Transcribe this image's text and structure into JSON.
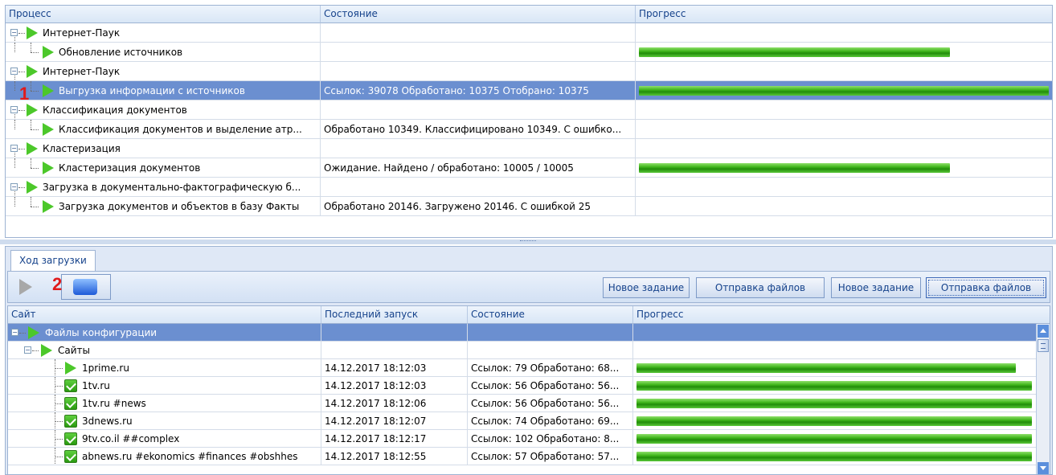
{
  "top_grid": {
    "columns": [
      "Процесс",
      "Состояние",
      "Прогресс"
    ],
    "rows": [
      {
        "level": 0,
        "expander": "⊖",
        "name": "Интернет-Паук",
        "state": "",
        "progress": null
      },
      {
        "level": 1,
        "name": "Обновление источников",
        "state": "",
        "progress": 0.75
      },
      {
        "level": 0,
        "expander": "⊖",
        "name": "Интернет-Паук",
        "state": "",
        "progress": null
      },
      {
        "level": 1,
        "name": "Выгрузка информации с источников",
        "state": "Ссылок: 39078 Обработано: 10375 Отобрано: 10375",
        "progress": 1.0,
        "selected": true
      },
      {
        "level": 0,
        "expander": "⊖",
        "name": "Классификация документов",
        "state": "",
        "progress": null
      },
      {
        "level": 1,
        "name": "Классификация документов и выделение атр...",
        "state": "Обработано 10349. Классифицировано 10349. С ошибко...",
        "progress": null
      },
      {
        "level": 0,
        "expander": "⊖",
        "name": "Кластеризация",
        "state": "",
        "progress": null
      },
      {
        "level": 1,
        "name": "Кластеризация документов",
        "state": "Ожидание. Найдено / обработано: 10005 / 10005",
        "progress": 0.75
      },
      {
        "level": 0,
        "expander": "⊖",
        "name": "Загрузка в документально-фактографическую б...",
        "state": "",
        "progress": null
      },
      {
        "level": 1,
        "name": "Загрузка документов и объектов в базу Факты",
        "state": "Обработано 20146. Загружено 20146. С ошибкой 25",
        "progress": null
      }
    ]
  },
  "markers": {
    "one": "1",
    "two": "2"
  },
  "bottom": {
    "tab_label": "Ход загрузки",
    "toolbar": {
      "buttons": [
        "Новое задание",
        "Отправка файлов",
        "Новое задание",
        "Отправка файлов"
      ]
    },
    "grid": {
      "columns": [
        "Сайт",
        "Последний запуск",
        "Состояние",
        "Прогресс"
      ],
      "rows": [
        {
          "level": 0,
          "expander": "⊖",
          "icon": "play",
          "site": "Файлы конфигурации",
          "last_run": "",
          "state": "",
          "progress": null,
          "selected": true
        },
        {
          "level": 1,
          "expander": "⊖",
          "icon": "play",
          "site": "Сайты",
          "last_run": "",
          "state": "",
          "progress": null
        },
        {
          "level": 2,
          "icon": "play",
          "site": "1prime.ru",
          "last_run": "14.12.2017 18:12:03",
          "state": "Ссылок: 79 Обработано: 68...",
          "progress": 0.96
        },
        {
          "level": 2,
          "icon": "check",
          "site": "1tv.ru",
          "last_run": "14.12.2017 18:12:03",
          "state": "Ссылок: 56 Обработано: 56...",
          "progress": 1.0
        },
        {
          "level": 2,
          "icon": "check",
          "site": "1tv.ru #news",
          "last_run": "14.12.2017 18:12:06",
          "state": "Ссылок: 56 Обработано: 56...",
          "progress": 1.0
        },
        {
          "level": 2,
          "icon": "check",
          "site": "3dnews.ru",
          "last_run": "14.12.2017 18:12:07",
          "state": "Ссылок: 74 Обработано: 69...",
          "progress": 1.0
        },
        {
          "level": 2,
          "icon": "check",
          "site": "9tv.co.il ##complex",
          "last_run": "14.12.2017 18:12:17",
          "state": "Ссылок: 102 Обработано: 8...",
          "progress": 1.0
        },
        {
          "level": 2,
          "icon": "check",
          "site": "abnews.ru #ekonomics #finances #obshhes",
          "last_run": "14.12.2017 18:12:55",
          "state": "Ссылок: 57 Обработано: 57...",
          "progress": 1.0
        }
      ]
    }
  },
  "colors": {
    "selection": "#6b8fd0",
    "progress_green": "#3fb51b",
    "header_text": "#15428b",
    "marker_red": "#e01b1b"
  }
}
